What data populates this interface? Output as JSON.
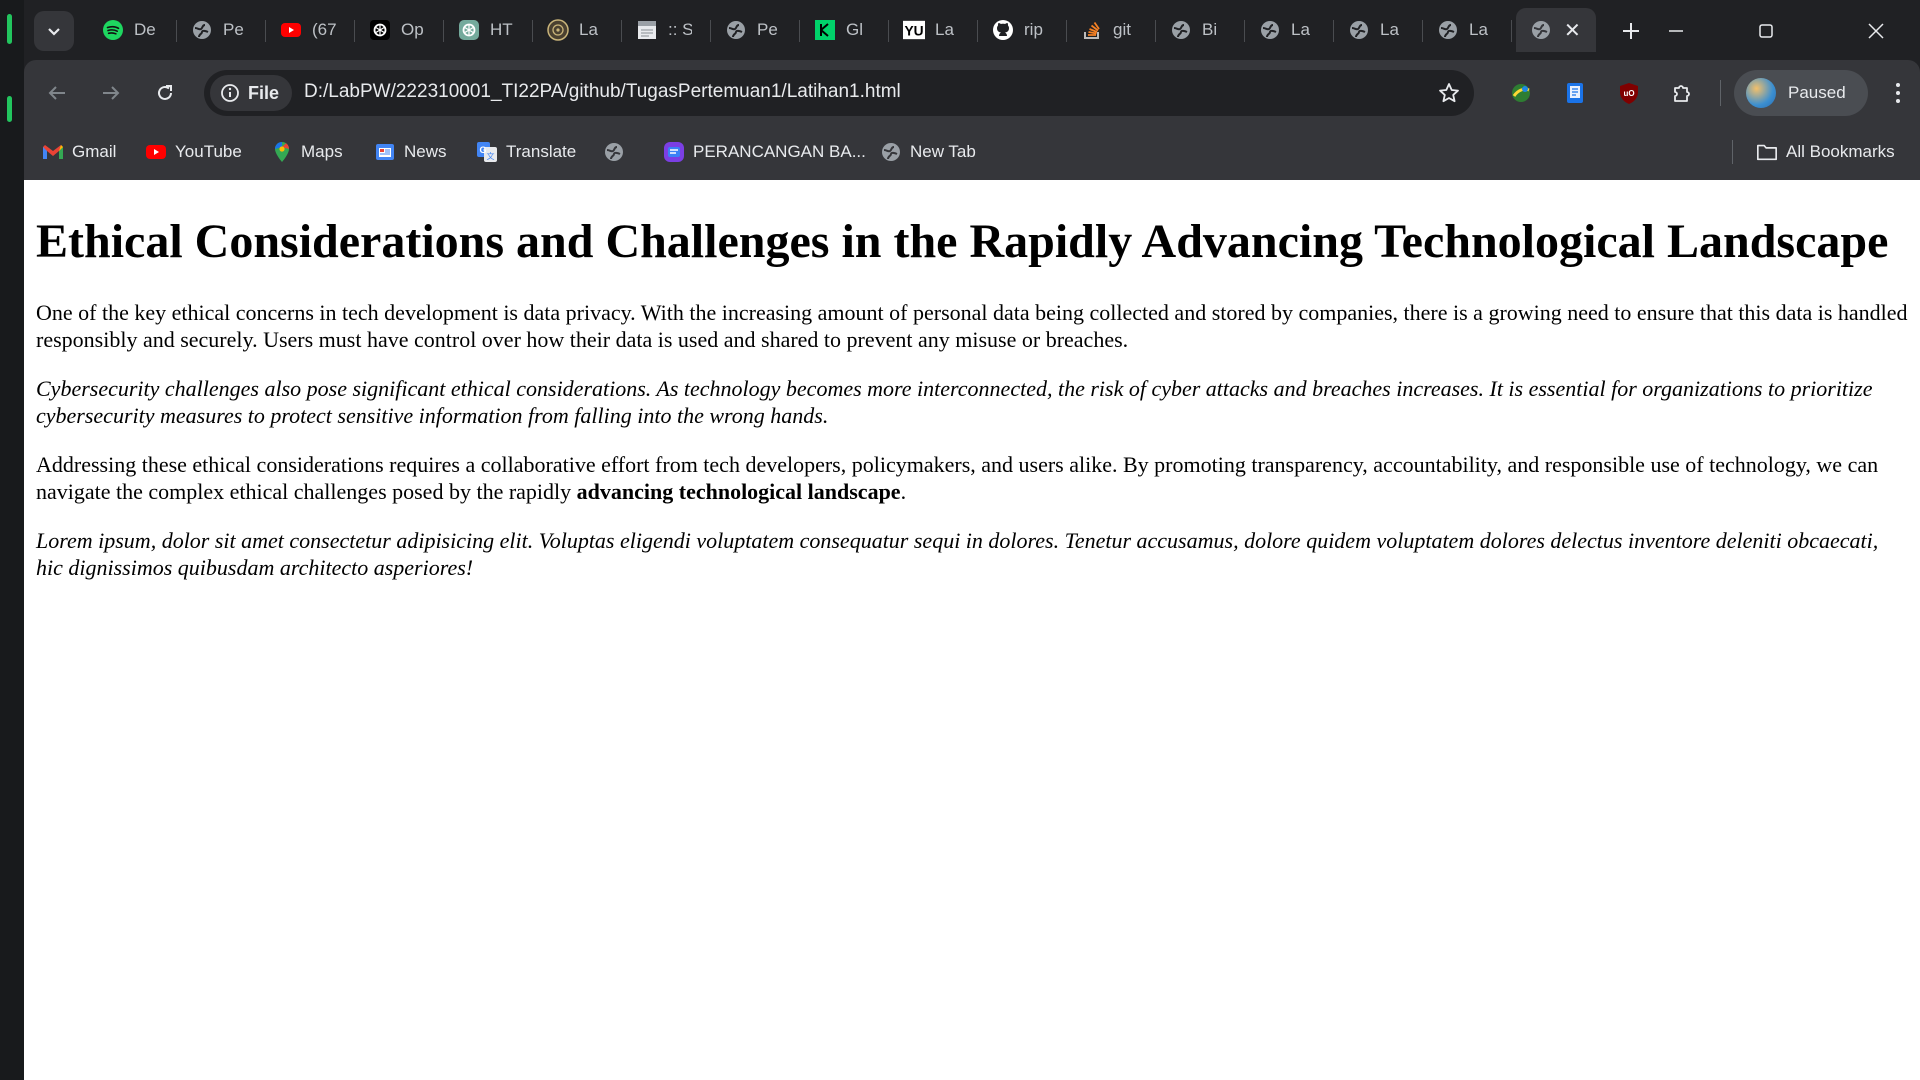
{
  "tabs": [
    {
      "title": "De",
      "icon": "spotify-icon"
    },
    {
      "title": "Pe",
      "icon": "globe-icon"
    },
    {
      "title": "(67",
      "icon": "youtube-icon"
    },
    {
      "title": "Op",
      "icon": "openai-icon"
    },
    {
      "title": "HT",
      "icon": "chatgpt-icon"
    },
    {
      "title": "La",
      "icon": "university-icon"
    },
    {
      "title": ":: S",
      "icon": "document-icon"
    },
    {
      "title": "Pe",
      "icon": "globe-icon"
    },
    {
      "title": "Gl",
      "icon": "glints-icon"
    },
    {
      "title": "La",
      "icon": "yu-icon"
    },
    {
      "title": "rip",
      "icon": "github-icon"
    },
    {
      "title": "git",
      "icon": "stackoverflow-icon"
    },
    {
      "title": "Bi",
      "icon": "globe-icon"
    },
    {
      "title": "La",
      "icon": "globe-icon"
    },
    {
      "title": "La",
      "icon": "globe-icon"
    },
    {
      "title": "La",
      "icon": "globe-icon"
    }
  ],
  "active_tab": {
    "icon": "globe-icon"
  },
  "toolbar": {
    "chip_label": "File",
    "url": "D:/LabPW/222310001_TI22PA/github/TugasPertemuan1/Latihan1.html",
    "profile_label": "Paused"
  },
  "bookmarks": [
    {
      "label": "Gmail",
      "icon": "gmail-icon"
    },
    {
      "label": "YouTube",
      "icon": "youtube-icon"
    },
    {
      "label": "Maps",
      "icon": "maps-icon"
    },
    {
      "label": "News",
      "icon": "news-icon"
    },
    {
      "label": "Translate",
      "icon": "translate-icon"
    },
    {
      "label": "",
      "icon": "globe-icon"
    },
    {
      "label": "PERANCANGAN BA...",
      "icon": "app-icon"
    },
    {
      "label": "New Tab",
      "icon": "globe-icon"
    }
  ],
  "all_bookmarks_label": "All Bookmarks",
  "content": {
    "heading": "Ethical Considerations and Challenges in the Rapidly Advancing Technological Landscape",
    "p1": "One of the key ethical concerns in tech development is data privacy. With the increasing amount of personal data being collected and stored by companies, there is a growing need to ensure that this data is handled responsibly and securely. Users must have control over how their data is used and shared to prevent any misuse or breaches.",
    "p2": "Cybersecurity challenges also pose significant ethical considerations. As technology becomes more interconnected, the risk of cyber attacks and breaches increases. It is essential for organizations to prioritize cybersecurity measures to protect sensitive information from falling into the wrong hands.",
    "p3_text": "Addressing these ethical considerations requires a collaborative effort from tech developers, policymakers, and users alike. By promoting transparency, accountability, and responsible use of technology, we can navigate the complex ethical challenges posed by the rapidly ",
    "p3_bold": "advancing technological landscape",
    "p3_end": ".",
    "p4": "Lorem ipsum, dolor sit amet consectetur adipisicing elit. Voluptas eligendi voluptatem consequatur sequi in dolores. Tenetur accusamus, dolore quidem voluptatem dolores delectus inventore deleniti obcaecati, hic dignissimos quibusdam architecto asperiores!"
  }
}
